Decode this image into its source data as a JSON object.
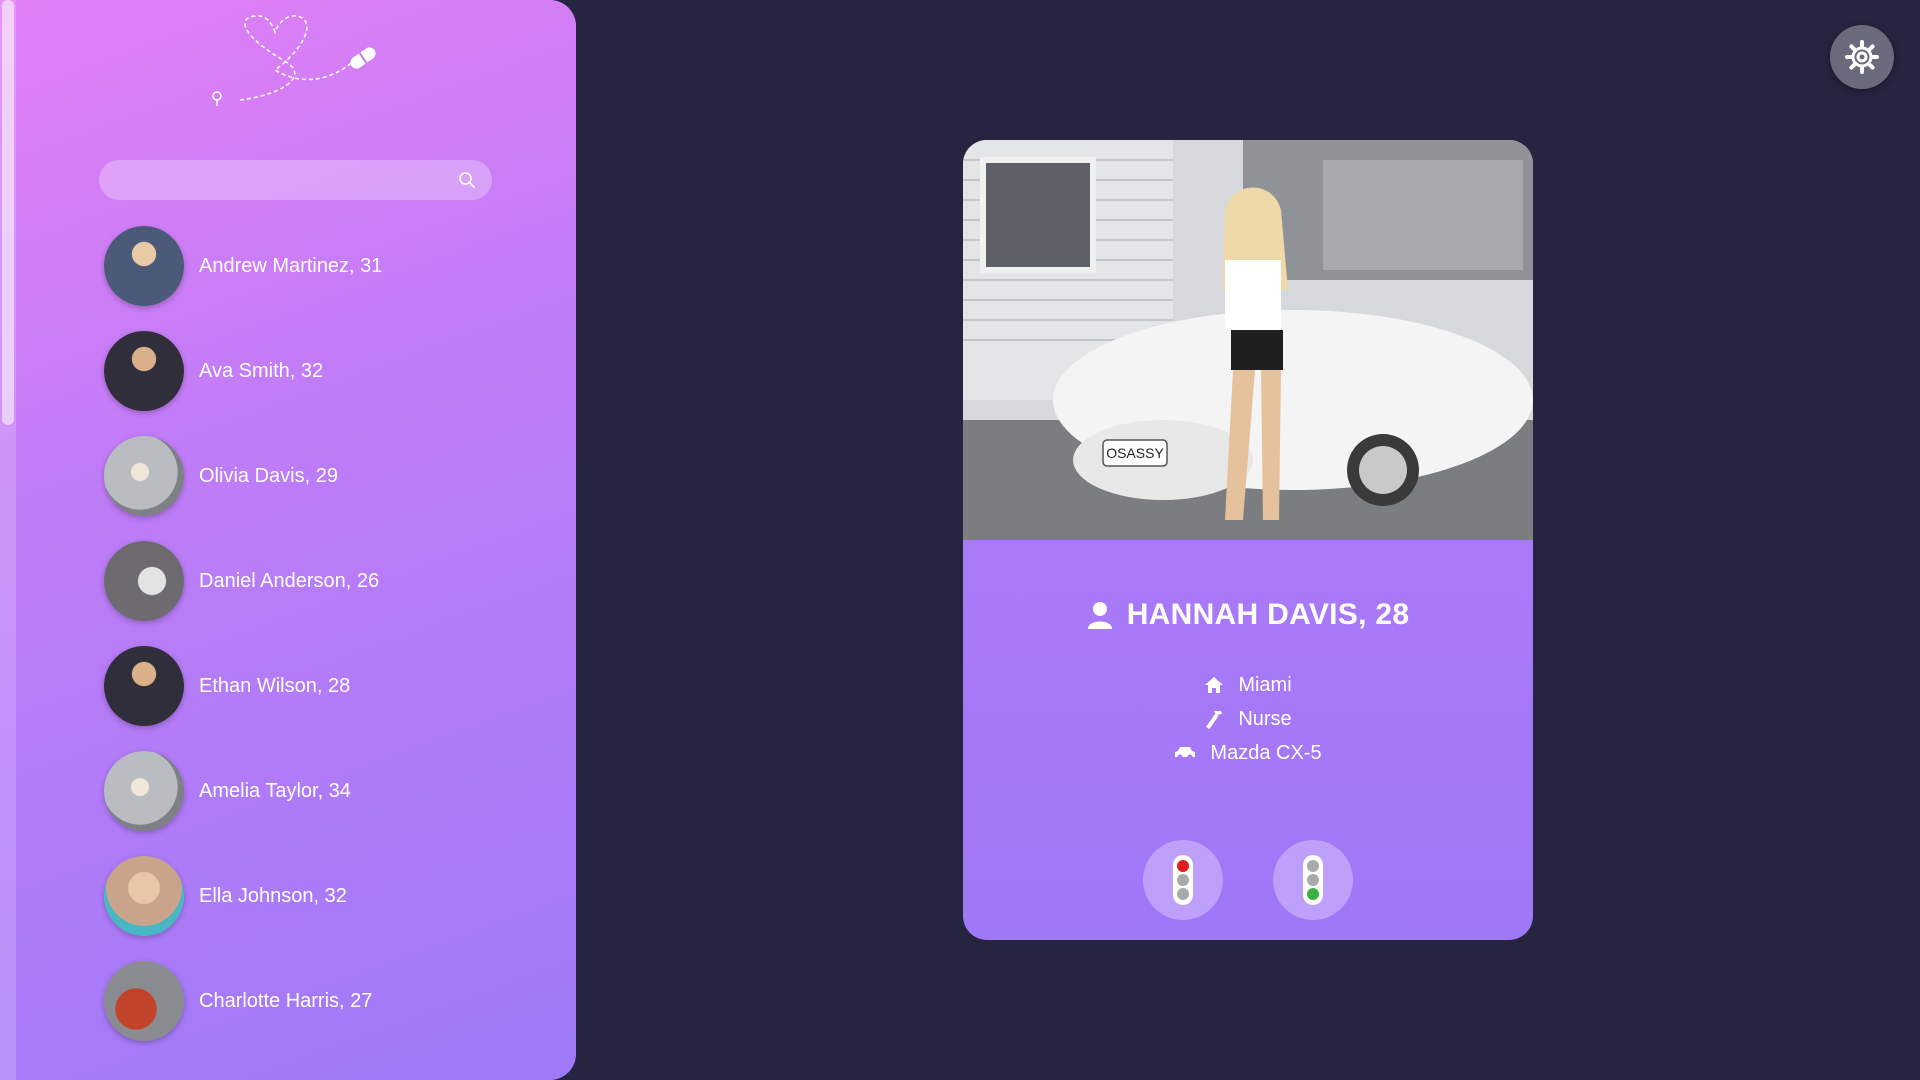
{
  "sidebar": {
    "search": {
      "placeholder": "",
      "value": ""
    },
    "people": [
      {
        "label": "Andrew Martinez, 31",
        "avatar_color": "#4a5a78"
      },
      {
        "label": "Ava Smith, 32",
        "avatar_color": "#3b3a4a"
      },
      {
        "label": "Olivia Davis, 29",
        "avatar_color": "#b9bcc1"
      },
      {
        "label": "Daniel Anderson, 26",
        "avatar_color": "#6d6b70"
      },
      {
        "label": "Ethan Wilson, 28",
        "avatar_color": "#3b3a4a"
      },
      {
        "label": "Amelia Taylor, 34",
        "avatar_color": "#b9bcc1"
      },
      {
        "label": "Ella Johnson, 32",
        "avatar_color": "#c9a48a"
      },
      {
        "label": "Charlotte Harris, 27",
        "avatar_color": "#c2452b"
      }
    ]
  },
  "profile": {
    "name": "HANNAH DAVIS, 28",
    "name_icon": "user-icon",
    "city": "Miami",
    "city_icon": "home-icon",
    "job": "Nurse",
    "job_icon": "hammer-icon",
    "car": "Mazda CX-5",
    "car_icon": "car-icon",
    "plate_text": "OSASSY"
  },
  "actions": {
    "dislike_icon": "traffic-light-red-icon",
    "like_icon": "traffic-light-green-icon"
  },
  "colors": {
    "background": "#252540",
    "accent": "#b57af8",
    "red_light": "#e01e1e",
    "green_light": "#3cb043"
  }
}
